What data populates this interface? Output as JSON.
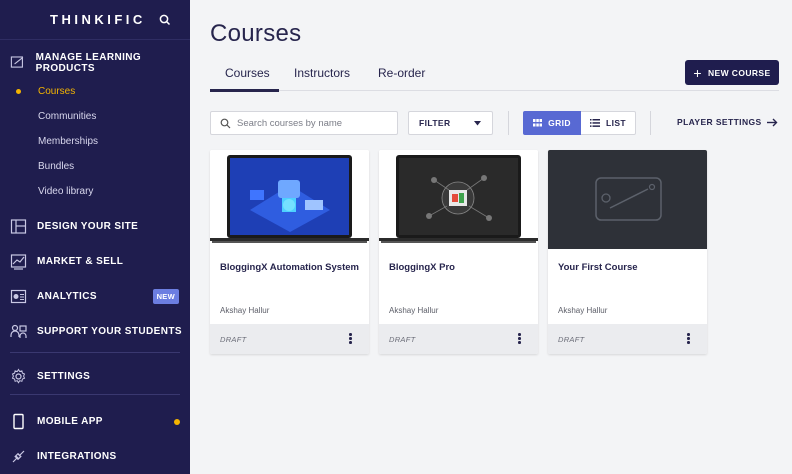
{
  "sidebar": {
    "logo": "THINKIFIC",
    "sections": [
      {
        "label": "MANAGE LEARNING PRODUCTS",
        "icon": "edit-icon"
      },
      {
        "label": "DESIGN YOUR SITE",
        "icon": "layout-icon"
      },
      {
        "label": "MARKET & SELL",
        "icon": "chart-line-icon"
      },
      {
        "label": "ANALYTICS",
        "icon": "analytics-icon",
        "badge": "NEW"
      },
      {
        "label": "SUPPORT YOUR STUDENTS",
        "icon": "students-icon"
      },
      {
        "label": "SETTINGS",
        "icon": "gear-icon"
      },
      {
        "label": "MOBILE APP",
        "icon": "phone-icon"
      },
      {
        "label": "INTEGRATIONS",
        "icon": "plug-icon"
      }
    ],
    "sub_items": [
      {
        "label": "Courses",
        "active": true
      },
      {
        "label": "Communities"
      },
      {
        "label": "Memberships"
      },
      {
        "label": "Bundles"
      },
      {
        "label": "Video library"
      }
    ]
  },
  "main": {
    "title": "Courses",
    "tabs": [
      {
        "label": "Courses",
        "active": true
      },
      {
        "label": "Instructors"
      },
      {
        "label": "Re-order"
      }
    ],
    "new_course_label": "NEW COURSE",
    "search_placeholder": "Search courses by name",
    "filter_label": "FILTER",
    "grid_label": "GRID",
    "list_label": "LIST",
    "player_settings_label": "PLAYER SETTINGS"
  },
  "cards": [
    {
      "title": "BloggingX Automation System",
      "author": "Akshay Hallur",
      "status": "DRAFT"
    },
    {
      "title": "BloggingX Pro",
      "author": "Akshay Hallur",
      "status": "DRAFT"
    },
    {
      "title": "Your First Course",
      "author": "Akshay Hallur",
      "status": "DRAFT"
    }
  ],
  "colors": {
    "sidebar_bg": "#1f1d4e",
    "accent": "#5869d3",
    "active_nav": "#f4b400",
    "primary_button": "#1f1d4e"
  }
}
